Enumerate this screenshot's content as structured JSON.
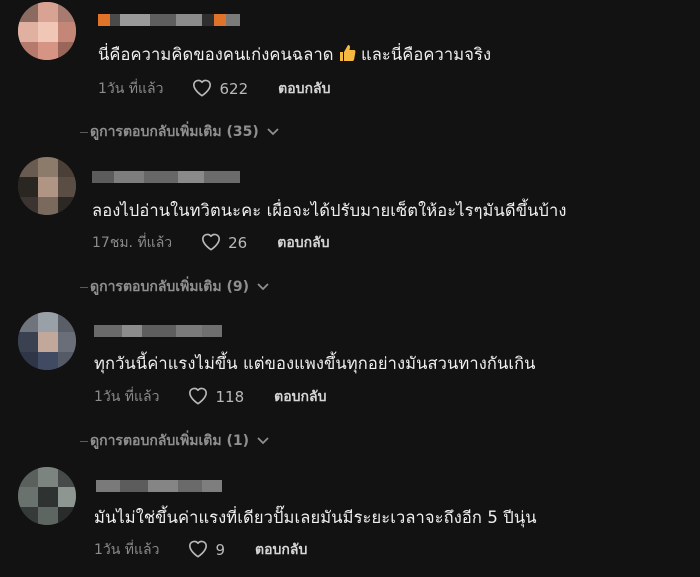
{
  "comments": [
    {
      "text": "นี่คือความคิดของคนเก่งคนฉลาด",
      "text_after": " และนี่คือความจริง",
      "emoji": "thumbs-up",
      "time": "1วัน ที่แล้ว",
      "likes": "622",
      "reply_label": "ตอบกลับ",
      "more_replies": "ดูการตอบกลับเพิ่มเติม (35)"
    },
    {
      "text": "ลองไปอ่านในทวิตนะคะ เผื่อจะได้ปรับมายเซ็ตให้อะไรๆมันดีขึ้นบ้าง",
      "time": "17ชม. ที่แล้ว",
      "likes": "26",
      "reply_label": "ตอบกลับ",
      "more_replies": "ดูการตอบกลับเพิ่มเติม (9)"
    },
    {
      "text": "ทุกวันนี้ค่าแรงไม่ขึ้น แต่ของแพงขึ้นทุกอย่างมันสวนทางกันเกิน",
      "time": "1วัน ที่แล้ว",
      "likes": "118",
      "reply_label": "ตอบกลับ",
      "more_replies": "ดูการตอบกลับเพิ่มเติม (1)"
    },
    {
      "text": "มันไม่ใช่ขึ้นค่าแรงที่เดียวปั๊มเลยมันมีระยะเวลาจะถึงอีก 5 ปีนุ่น",
      "time": "1วัน ที่แล้ว",
      "likes": "9",
      "reply_label": "ตอบกลับ"
    }
  ],
  "colors": {
    "background": "#121212",
    "text": "#f0f0f0",
    "muted": "#8a8a8a",
    "emoji": "#f5b942"
  },
  "icons": {
    "like": "heart-outline-icon",
    "expand": "chevron-down-icon",
    "emoji": "thumbs-up-emoji-icon"
  }
}
